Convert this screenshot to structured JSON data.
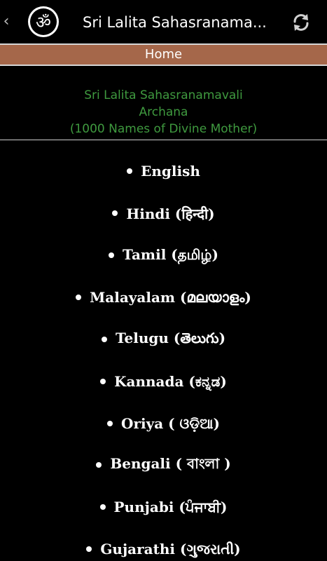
{
  "action_bar": {
    "back_icon": "chevron-left-icon",
    "logo_icon": "om-icon",
    "logo_glyph": "ॐ",
    "title": "Sri Lalita Sahasranama...",
    "refresh_icon": "refresh-icon"
  },
  "home_bar": {
    "label": "Home"
  },
  "header": {
    "line1": "Sri Lalita Sahasranamavali",
    "line2": "Archana",
    "line3": "(1000 Names of Divine Mother)"
  },
  "languages": [
    {
      "label": "English"
    },
    {
      "label": "Hindi (हिन्दी)"
    },
    {
      "label": "Tamil (தமிழ்)"
    },
    {
      "label": "Malayalam (മലയാളം)"
    },
    {
      "label": "Telugu (తెలుగు)"
    },
    {
      "label": "Kannada (ಕನ್ನಡ)"
    },
    {
      "label": "Oriya ( ଓଡ଼ିଆ)"
    },
    {
      "label": "Bengali ( বাংলা )"
    },
    {
      "label": "Punjabi (ਪੰਜਾਬੀ)"
    },
    {
      "label": "Gujarathi (ગુજરાતી)"
    }
  ],
  "colors": {
    "background": "#000000",
    "home_bar": "#a5674a",
    "header_text": "#3f9a3f",
    "text": "#ffffff"
  }
}
